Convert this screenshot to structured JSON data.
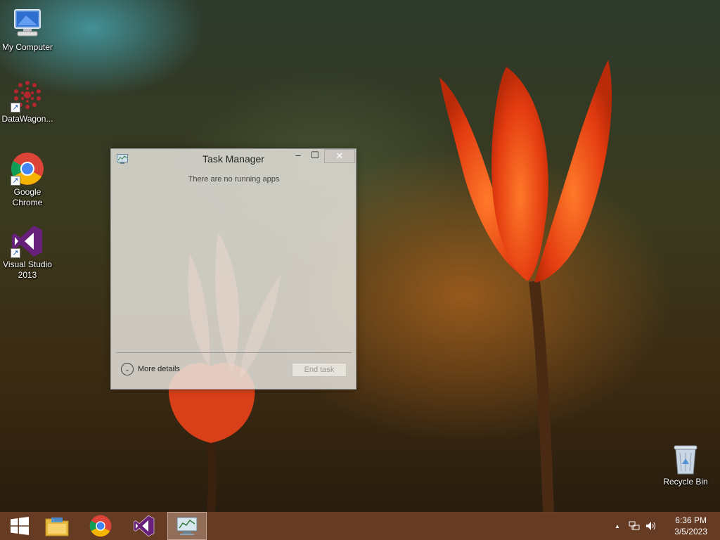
{
  "desktop": {
    "icons": [
      {
        "label": "My Computer",
        "icon": "computer-icon"
      },
      {
        "label": "DataWagon...",
        "icon": "datawagon-icon"
      },
      {
        "label": "Google Chrome",
        "icon": "chrome-icon"
      },
      {
        "label": "Visual Studio 2013",
        "icon": "visual-studio-icon"
      },
      {
        "label": "Recycle Bin",
        "icon": "recycle-bin-icon"
      }
    ]
  },
  "task_manager": {
    "title": "Task Manager",
    "minimize_glyph": "–",
    "maximize_glyph": "☐",
    "close_glyph": "✕",
    "empty_message": "There are no running apps",
    "more_details_label": "More details",
    "end_task_label": "End task"
  },
  "taskbar": {
    "items": [
      "start-button",
      "file-explorer-icon",
      "chrome-icon",
      "visual-studio-icon",
      "task-manager-icon"
    ],
    "tray": {
      "show_hidden_glyph": "▲",
      "time": "6:36 PM",
      "date": "3/5/2023"
    }
  },
  "colors": {
    "taskbar": "#704028",
    "window_bg": "#e4e2dc",
    "vs_purple": "#68217a"
  }
}
